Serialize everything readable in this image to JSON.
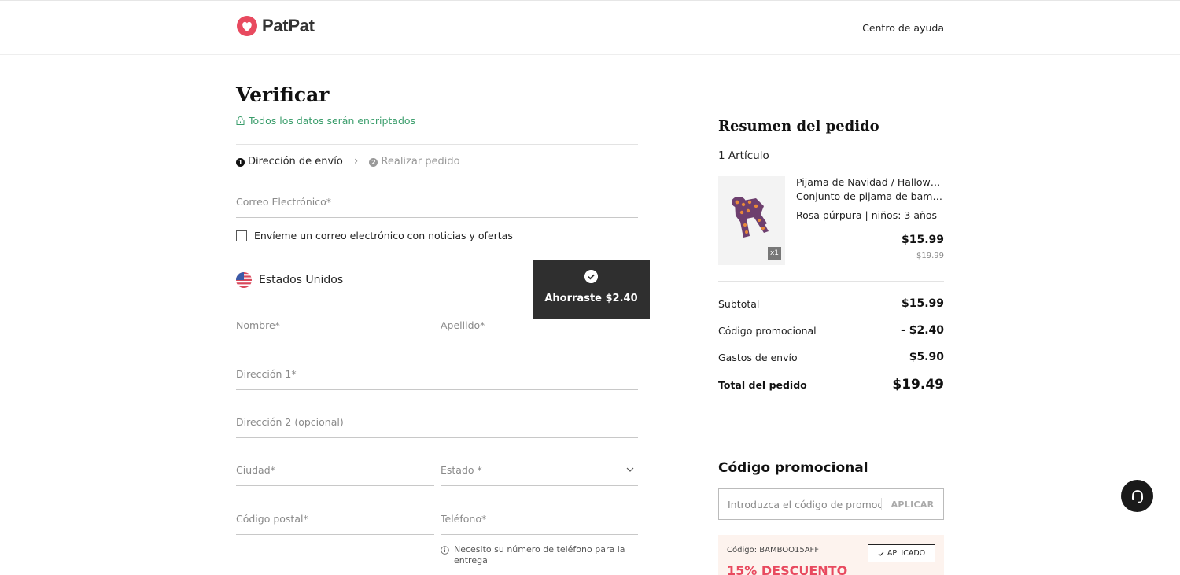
{
  "header": {
    "brand": "PatPat",
    "help_link": "Centro de ayuda"
  },
  "checkout": {
    "title": "Verificar",
    "secure_note": "Todos los datos serán encriptados",
    "steps": [
      {
        "num": "1",
        "label": "Dirección de envío"
      },
      {
        "num": "2",
        "label": "Realizar pedido"
      }
    ],
    "email_placeholder": "Correo Electrónico*",
    "newsletter_label": "Envíeme un correo electrónico con noticias y ofertas",
    "country": "Estados Unidos",
    "first_name_placeholder": "Nombre*",
    "last_name_placeholder": "Apellido*",
    "address1_placeholder": "Dirección 1*",
    "address2_placeholder": "Dirección 2 (opcional)",
    "city_placeholder": "Ciudad*",
    "state_placeholder": "Estado *",
    "zip_placeholder": "Código postal*",
    "phone_placeholder": "Teléfono*",
    "phone_note": "Necesito su número de teléfono para la entrega"
  },
  "toast": {
    "text": "Ahorraste $2.40"
  },
  "summary": {
    "title": "Resumen del pedido",
    "item_count": "1 Artículo",
    "product": {
      "name_line1": "Pijama de Navidad / Halloween",
      "name_line2": "Conjunto de pijama de bambú...",
      "variant": "Rosa púrpura | niños: 3 años",
      "price": "$15.99",
      "old_price": "$19.99",
      "qty": "x1"
    },
    "rows": [
      {
        "label": "Subtotal",
        "value": "$15.99"
      },
      {
        "label": "Código promocional",
        "value": "- $2.40"
      },
      {
        "label": "Gastos de envío",
        "value": "$5.90"
      }
    ],
    "total": {
      "label": "Total del pedido",
      "value": "$19.49"
    }
  },
  "promo": {
    "title": "Código promocional",
    "placeholder": "Introduzca el código de promoción",
    "apply_label": "APLICAR",
    "applied_code": "Código: BAMBOO15AFF",
    "applied_label": "APLICADO",
    "applied_discount": "15% DESCUENTO"
  },
  "colors": {
    "brand": "#e84a5f",
    "secure_green": "#3a9d6b",
    "toast_bg": "#2f2f2f"
  }
}
